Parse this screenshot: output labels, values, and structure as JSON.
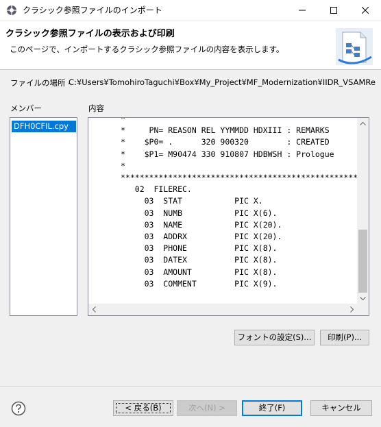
{
  "window": {
    "title": "クラシック参照ファイルのインポート"
  },
  "banner": {
    "title": "クラシック参照ファイルの表示および印刷",
    "description": "このページで、インポートするクラシック参照ファイルの内容を表示します。"
  },
  "location": {
    "label": "ファイルの場所 -",
    "path": "C:¥Users¥TomohiroTaguchi¥Box¥My_Project¥MF_Modernization¥IIDR_VSAMRemote"
  },
  "members": {
    "label": "メンバー",
    "items": [
      "DFH0CFIL.cpy"
    ]
  },
  "contents": {
    "label": "内容",
    "lines": [
      "*",
      "*     PN= REASON REL YYMMDD HDXIII : REMARKS",
      "*    $P0= .      320 900320        : CREATED",
      "*    $P1= M90474 330 910807 HDBWSH : Prologue",
      "*",
      "******************************************************",
      "   02  FILEREC.",
      "     03  STAT           PIC X.",
      "     03  NUMB           PIC X(6).",
      "     03  NAME           PIC X(20).",
      "     03  ADDRX          PIC X(20).",
      "     03  PHONE          PIC X(8).",
      "     03  DATEX          PIC X(8).",
      "     03  AMOUNT         PIC X(8).",
      "     03  COMMENT        PIC X(9)."
    ]
  },
  "buttons": {
    "font": "フォントの設定(S)...",
    "print": "印刷(P)...",
    "back": "< 戻る(B)",
    "next": "次へ(N) >",
    "finish": "終了(F)",
    "cancel": "キャンセル"
  },
  "colors": {
    "selection": "#0078d7",
    "background": "#f0f0f0"
  }
}
